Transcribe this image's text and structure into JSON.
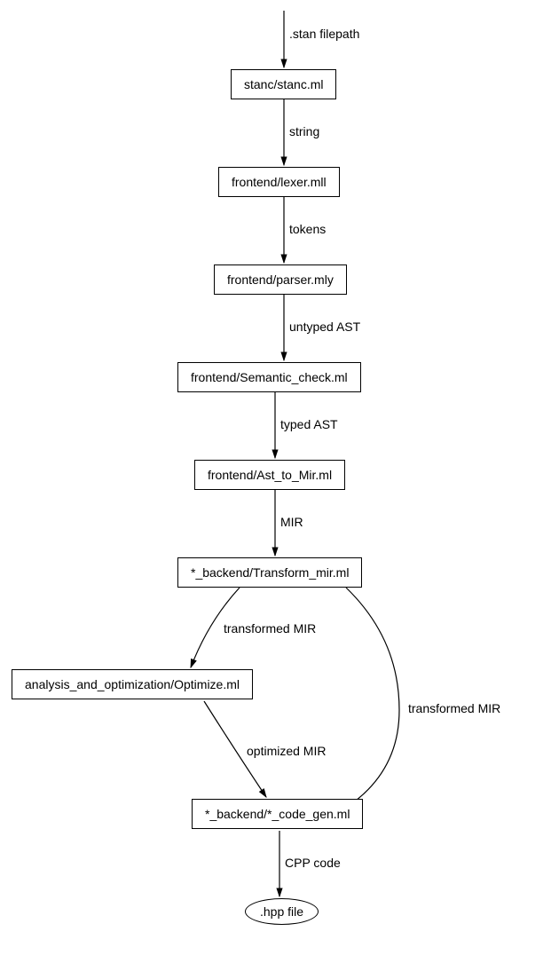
{
  "edges": {
    "e0": ".stan filepath",
    "e1": "string",
    "e2": "tokens",
    "e3": "untyped AST",
    "e4": "typed AST",
    "e5": "MIR",
    "e6": "transformed MIR",
    "e7": "transformed MIR",
    "e8": "optimized MIR",
    "e9": "CPP code"
  },
  "nodes": {
    "n0": "stanc/stanc.ml",
    "n1": "frontend/lexer.mll",
    "n2": "frontend/parser.mly",
    "n3": "frontend/Semantic_check.ml",
    "n4": "frontend/Ast_to_Mir.ml",
    "n5": "*_backend/Transform_mir.ml",
    "n6": "analysis_and_optimization/Optimize.ml",
    "n7": "*_backend/*_code_gen.ml",
    "n8": ".hpp file"
  }
}
